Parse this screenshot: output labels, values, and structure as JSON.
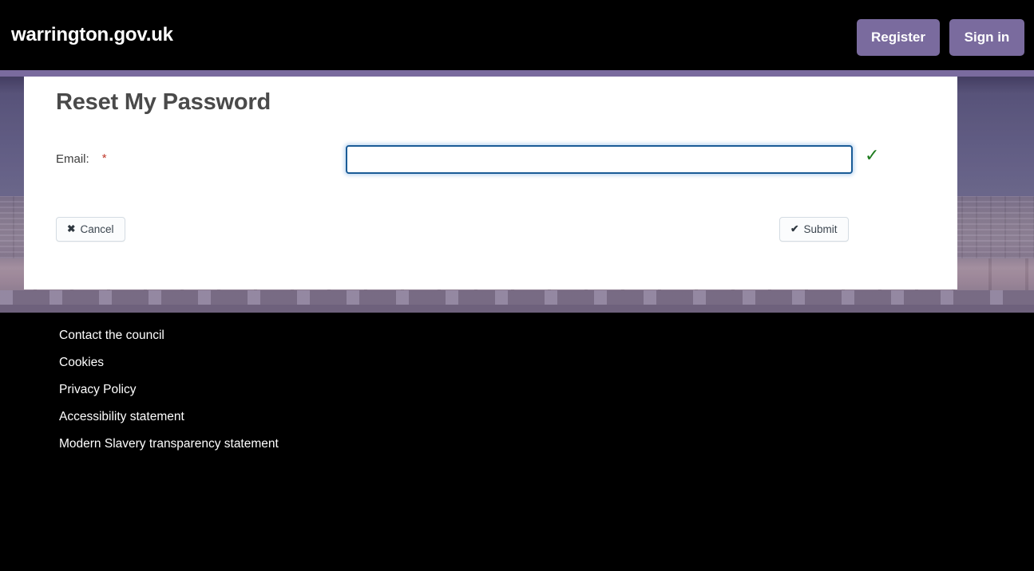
{
  "header": {
    "brand": "warrington.gov.uk",
    "register_label": "Register",
    "signin_label": "Sign in",
    "accent_color": "#7a6b9e",
    "background_color": "#000000"
  },
  "card": {
    "title": "Reset My Password",
    "form": {
      "email": {
        "label": "Email:",
        "required_marker": "*",
        "value": "",
        "placeholder": "",
        "validation_icon": "check-icon",
        "validation_glyph": "✓",
        "validation_color": "#1e7b1e",
        "border_color": "#1a5b96"
      }
    },
    "buttons": {
      "cancel": {
        "label": "Cancel",
        "icon": "cross-icon",
        "glyph": "✖"
      },
      "submit": {
        "label": "Submit",
        "icon": "check-icon",
        "glyph": "✔"
      }
    }
  },
  "footer": {
    "links": [
      {
        "label": "Contact the council"
      },
      {
        "label": "Cookies"
      },
      {
        "label": "Privacy Policy"
      },
      {
        "label": "Accessibility statement"
      },
      {
        "label": "Modern Slavery transparency statement"
      }
    ]
  }
}
